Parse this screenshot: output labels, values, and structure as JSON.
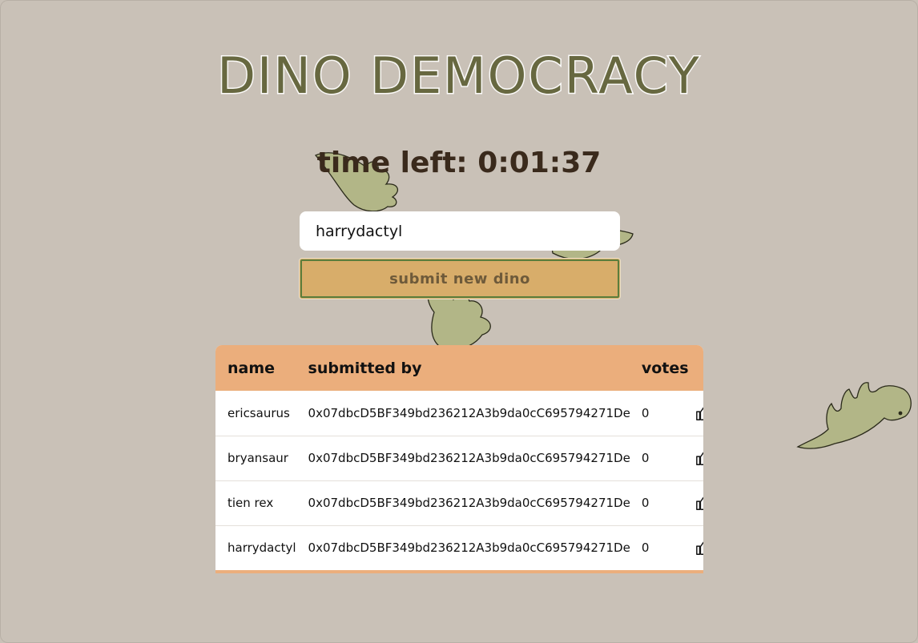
{
  "title": "DINO DEMOCRACY",
  "timer": {
    "label": "time left:",
    "value": "0:01:37"
  },
  "form": {
    "input_value": "harrydactyl",
    "submit_label": "submit new dino"
  },
  "table": {
    "headers": {
      "name": "name",
      "submitted_by": "submitted by",
      "votes": "votes"
    },
    "rows": [
      {
        "name": "ericsaurus",
        "submitted_by": "0x07dbcD5BF349bd236212A3b9da0cC695794271De",
        "votes": "0"
      },
      {
        "name": "bryansaur",
        "submitted_by": "0x07dbcD5BF349bd236212A3b9da0cC695794271De",
        "votes": "0"
      },
      {
        "name": "tien rex",
        "submitted_by": "0x07dbcD5BF349bd236212A3b9da0cC695794271De",
        "votes": "0"
      },
      {
        "name": "harrydactyl",
        "submitted_by": "0x07dbcD5BF349bd236212A3b9da0cC695794271De",
        "votes": "0"
      }
    ]
  },
  "colors": {
    "background": "#c9c1b7",
    "title": "#676840",
    "header": "#ebae7c",
    "button": "#d8ad6a",
    "dino": "#b4b886"
  },
  "icons": {
    "vote": "thumbs-up-icon",
    "decoration": "dinosaur-icon"
  }
}
